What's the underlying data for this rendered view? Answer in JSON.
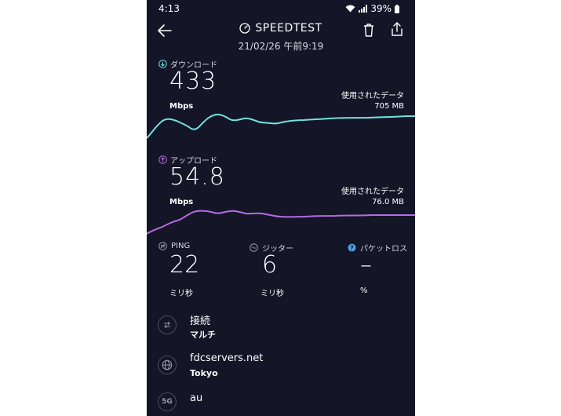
{
  "status": {
    "time": "4:13",
    "battery": "39%"
  },
  "header": {
    "title": "SPEEDTEST",
    "date": "21/02/26 午前9:19"
  },
  "download": {
    "label": "ダウンロード",
    "value": "433",
    "unit": "Mbps",
    "data_used_label": "使用されたデータ",
    "data_used_value": "705 MB",
    "color": "#6fe3e3"
  },
  "upload": {
    "label": "アップロード",
    "value": "54.8",
    "unit": "Mbps",
    "data_used_label": "使用されたデータ",
    "data_used_value": "76.0 MB",
    "color": "#b66be6"
  },
  "ping": {
    "label": "PING",
    "value": "22",
    "unit": "ミリ秒"
  },
  "jitter": {
    "label": "ジッター",
    "value": "6",
    "unit": "ミリ秒"
  },
  "packet_loss": {
    "label": "パケットロス",
    "value": "–",
    "unit": "%",
    "icon_color": "#4aa3e8"
  },
  "connection": {
    "title": "接続",
    "subtitle": "マルチ"
  },
  "server": {
    "title": "fdcservers.net",
    "subtitle": "Tokyo"
  },
  "provider": {
    "icon": "5G",
    "title": "au"
  }
}
